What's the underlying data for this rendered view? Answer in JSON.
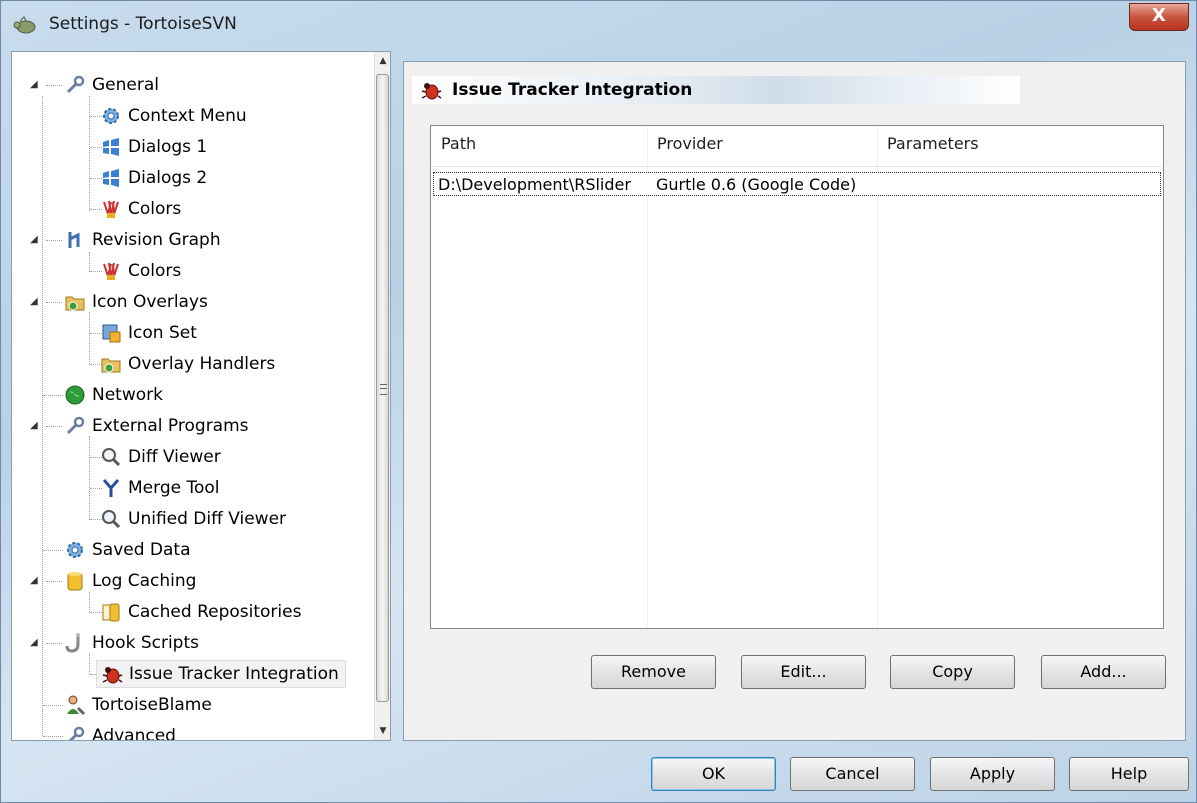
{
  "window": {
    "title": "Settings - TortoiseSVN",
    "close_label": "X"
  },
  "tree": {
    "items": [
      {
        "label": "General",
        "icon": "wrench-icon"
      },
      {
        "label": "Context Menu",
        "icon": "gear-icon"
      },
      {
        "label": "Dialogs 1",
        "icon": "dialogs-icon"
      },
      {
        "label": "Dialogs 2",
        "icon": "dialogs-icon"
      },
      {
        "label": "Colors",
        "icon": "paint-icon"
      },
      {
        "label": "Revision Graph",
        "icon": "graph-icon"
      },
      {
        "label": "Colors",
        "icon": "paint-icon"
      },
      {
        "label": "Icon Overlays",
        "icon": "folder-overlay-icon"
      },
      {
        "label": "Icon Set",
        "icon": "iconset-icon"
      },
      {
        "label": "Overlay Handlers",
        "icon": "folder-overlay-icon"
      },
      {
        "label": "Network",
        "icon": "globe-icon"
      },
      {
        "label": "External Programs",
        "icon": "wrench-icon"
      },
      {
        "label": "Diff Viewer",
        "icon": "magnifier-icon"
      },
      {
        "label": "Merge Tool",
        "icon": "merge-icon"
      },
      {
        "label": "Unified Diff Viewer",
        "icon": "magnifier-icon"
      },
      {
        "label": "Saved Data",
        "icon": "gear-icon"
      },
      {
        "label": "Log Caching",
        "icon": "database-icon"
      },
      {
        "label": "Cached Repositories",
        "icon": "database-icon"
      },
      {
        "label": "Hook Scripts",
        "icon": "hook-icon"
      },
      {
        "label": "Issue Tracker Integration",
        "icon": "bug-icon",
        "selected": true
      },
      {
        "label": "TortoiseBlame",
        "icon": "blame-icon"
      },
      {
        "label": "Advanced",
        "icon": "wrench-icon"
      }
    ]
  },
  "page": {
    "title": "Issue Tracker Integration",
    "icon": "bug-icon"
  },
  "table": {
    "columns": [
      "Path",
      "Provider",
      "Parameters"
    ],
    "rows": [
      {
        "path": "D:\\Development\\RSlider",
        "provider": "Gurtle 0.6 (Google Code)",
        "parameters": ""
      }
    ]
  },
  "page_buttons": {
    "remove": "Remove",
    "edit": "Edit...",
    "copy": "Copy",
    "add": "Add..."
  },
  "dialog_buttons": {
    "ok": "OK",
    "cancel": "Cancel",
    "apply": "Apply",
    "help": "Help"
  }
}
